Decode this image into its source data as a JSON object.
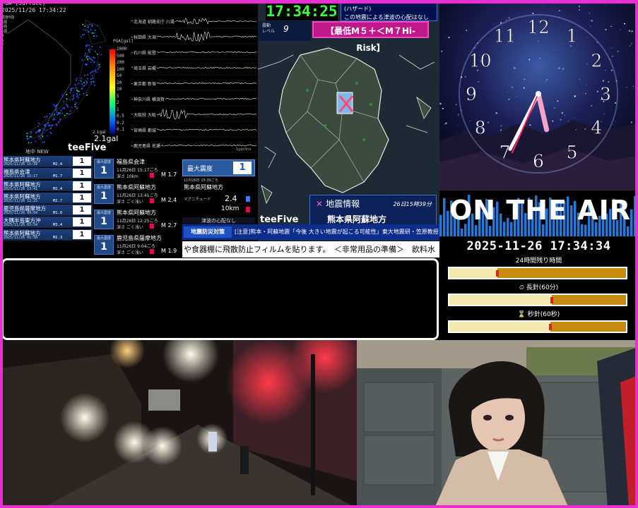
{
  "kmoni": {
    "pga_header": "PGA (Surface)",
    "timestamp": "2025/11/26 17:34:22",
    "station_counts": [
      "震度6強",
      "6弱",
      "5強",
      "5弱",
      "4",
      "3",
      "2",
      "1"
    ],
    "scale_label": "PGA[gal]",
    "scale_ticks": [
      "1000",
      "500",
      "200",
      "100",
      "50",
      "20",
      "10",
      "5",
      "2",
      "1",
      "0.5",
      "0.2",
      "0.1"
    ],
    "gal_small": "2.1gal",
    "gal_value": "2.1gal",
    "brand": "teeFive",
    "brand_sub": "地中 NEW",
    "wave_labels": [
      "北海道 釧路支庁 川湯",
      "秋田県 大潟",
      "石川県 能登",
      "埼玉県 岩槻",
      "東京都 新宿",
      "神奈川県 横須賀",
      "大阪府 大阪",
      "宮崎県 都城",
      "鹿児島県 名瀬"
    ],
    "wave_footer": "1gal/line",
    "quakes": [
      {
        "place": "熊本県阿蘇地方",
        "time": "2025/11/26 15:39",
        "mag": "M2.4",
        "int": "1"
      },
      {
        "place": "福島県会津",
        "time": "2025/11/26 15:17",
        "mag": "M1.7",
        "int": "1"
      },
      {
        "place": "熊本県阿蘇地方",
        "time": "2025/11/26 13:41",
        "mag": "M2.4",
        "int": "1"
      },
      {
        "place": "熊本県阿蘇地方",
        "time": "2025/11/26 12:25",
        "mag": "M2.7",
        "int": "1"
      },
      {
        "place": "鹿児島県薩摩地方",
        "time": "2025/11/26 09:04",
        "mag": "M1.0",
        "int": "1"
      },
      {
        "place": "大隅半島東方沖",
        "time": "2025/11/26 05:54",
        "mag": "M3.4",
        "int": "1"
      },
      {
        "place": "熊本県阿蘇地方",
        "time": "2025/11/26 01:58",
        "mag": "M2.3",
        "int": "1"
      }
    ],
    "details": [
      {
        "int_label": "最大震度",
        "int": "1",
        "place": "福島県会津",
        "time": "11月26日 15:17ごろ",
        "depth": "深さ 10km",
        "mag": "M 1.7"
      },
      {
        "int_label": "最大震度",
        "int": "1",
        "place": "熊本県阿蘇地方",
        "time": "11月26日 13:41ごろ",
        "depth": "深さ ごく浅い",
        "mag": "M 2.4"
      },
      {
        "int_label": "最大震度",
        "int": "1",
        "place": "熊本県阿蘇地方",
        "time": "11月26日 12:25ごろ",
        "depth": "深さ ごく浅い",
        "mag": "M 2.7"
      },
      {
        "int_label": "最大震度",
        "int": "1",
        "place": "鹿児島県薩摩地方",
        "time": "11月26日 9:04ごろ",
        "depth": "深さ ごく浅い",
        "mag": "M 1.9"
      }
    ],
    "max_int_label": "最大震度",
    "max_int": "1",
    "hypo_time": "11月26日 15:39ごろ",
    "hypo_place": "熊本県阿蘇地方",
    "hypo_mag_label": "マグニチュード",
    "hypo_mag": "2.4",
    "hypo_depth": "10km",
    "tsunami": "津波の心配なし"
  },
  "quake_map": {
    "clock": "17:34:25",
    "note_line1": "(ハザード)",
    "note_line2": "この地震による津波の心配はなし",
    "level_label_1": "震動",
    "level_label_2": "レベル",
    "level_value": "9",
    "risk_badge": "【最低M５＋＜M７Hi-Risk】",
    "brand": "teeFive",
    "info_title": "地震情報",
    "info_time": "26日15時39分",
    "info_place": "熊本県阿蘇地方"
  },
  "ticker": {
    "tag": "地震防災対策",
    "news": "[注意]熊本・阿蘇地震「今後 大きい地震が起こる可能性」東大地震研・笠原教授",
    "scroll": "や食器棚に飛散防止フィルムを貼ります。　＜非常用品の準備＞　飲料水"
  },
  "clock": {
    "numbers": [
      "12",
      "1",
      "2",
      "3",
      "4",
      "5",
      "6",
      "7",
      "8",
      "9",
      "10",
      "11"
    ],
    "hour": 5.57,
    "minute": 34.5,
    "second": 34
  },
  "onair": {
    "text": "ON THE AIR"
  },
  "timers": {
    "datetime": "2025-11-26 17:34:34",
    "items": [
      {
        "label": "24時間残り時間",
        "fill": 0.27
      },
      {
        "label": "長針(60分)",
        "fill": 0.58
      },
      {
        "label": "秒針(60秒)",
        "fill": 0.57
      }
    ]
  },
  "colors": {
    "frame": "#e92fd4",
    "ticker_blue": "#0c2d8a",
    "timer_gold": "#c78b0f",
    "clock_green": "#39ff3b",
    "badge_magenta": "#c0188a"
  }
}
